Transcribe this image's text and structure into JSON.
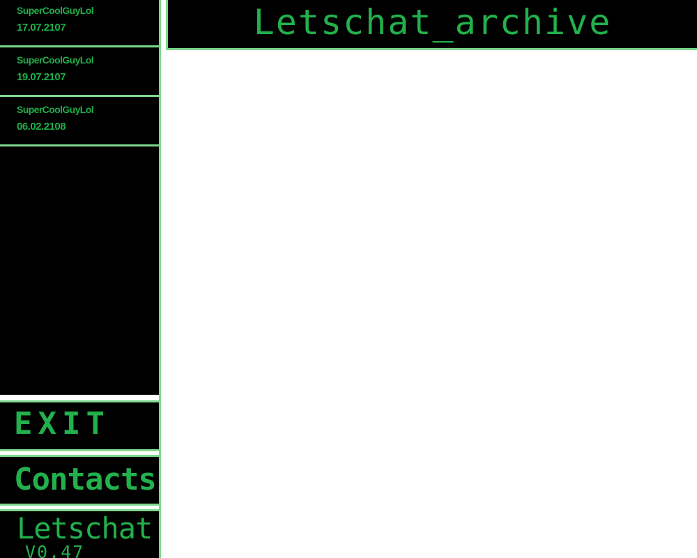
{
  "header": {
    "title": "Letschat_archive"
  },
  "sidebar": {
    "chats": [
      {
        "name": "SuperCoolGuyLol",
        "date": "17.07.2107"
      },
      {
        "name": "SuperCoolGuyLol",
        "date": "19.07.2107"
      },
      {
        "name": "SuperCoolGuyLol",
        "date": "06.02.2108"
      }
    ],
    "exit_label": "EXIT",
    "contacts_label": "Contacts",
    "brand": {
      "name": "Letschat",
      "version": "V0.47"
    }
  },
  "colors": {
    "accent": "#22b14c",
    "border": "#7ed88f",
    "panel": "#000000",
    "background": "#ffffff"
  }
}
